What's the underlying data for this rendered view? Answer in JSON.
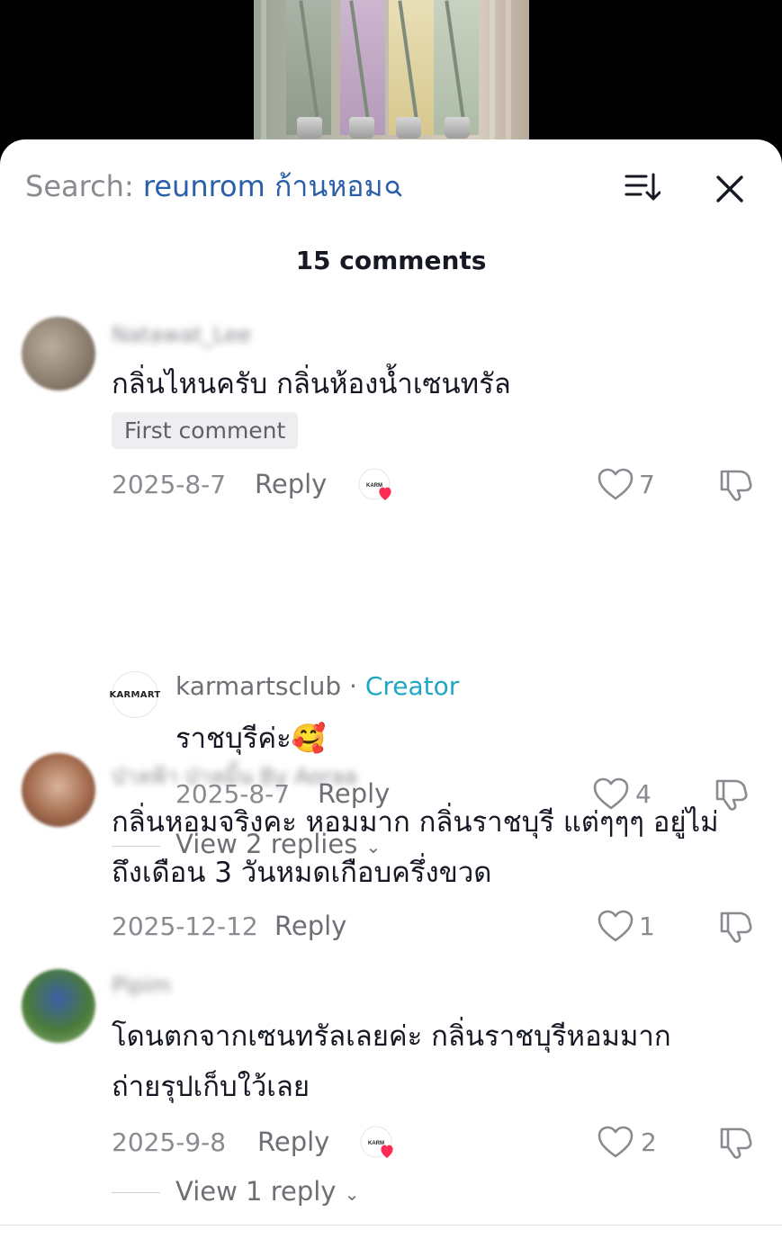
{
  "sheet": {
    "search_prefix": "Search: ",
    "search_term": "reunrom ก้านหอม",
    "comment_count": "15 comments"
  },
  "comments": [
    {
      "username": "Natawat_Lee",
      "text": "กลิ่นไหนครับ กลิ่นห้องน้ำเซนทรัล",
      "badge": "First comment",
      "date": "2025-8-7",
      "reply_label": "Reply",
      "creator_liked_badge": "KARM",
      "likes": "7",
      "creator_reply": {
        "avatar_text": "KARMART",
        "username": "karmartsclub",
        "separator": " · ",
        "tag": "Creator",
        "text": "ราชบุรีค่ะ🥰",
        "date": "2025-8-7",
        "reply_label": "Reply",
        "likes": "4"
      },
      "view_replies": "View 2 replies"
    },
    {
      "username": "ป่าลฟ้า ป่าลมิ้น By Aoraa",
      "text_line1": "กลิ่นหอมจริงคะ หอมมาก กลิ่นราชบุรี แต่ๆๆๆ อยู่ไม่",
      "text_line2": "ถึงเดือน 3 วันหมดเกือบครึ่งขวด",
      "date": "2025-12-12",
      "reply_label": "Reply",
      "likes": "1"
    },
    {
      "username": "Pipim",
      "text_line1": "โดนตกจากเซนทรัลเลยค่ะ กลิ่นราชบุรีหอมมาก",
      "text_line2": "ถ่ายรุปเก็บใว้เลย",
      "date": "2025-9-8",
      "reply_label": "Reply",
      "creator_liked_badge": "KARM",
      "likes": "2",
      "view_replies": "View 1 reply"
    }
  ],
  "colors": {
    "accent_blue": "#2b5fa8",
    "creator_tag": "#1ea7c5",
    "like_badge_heart": "#fe2c55"
  }
}
